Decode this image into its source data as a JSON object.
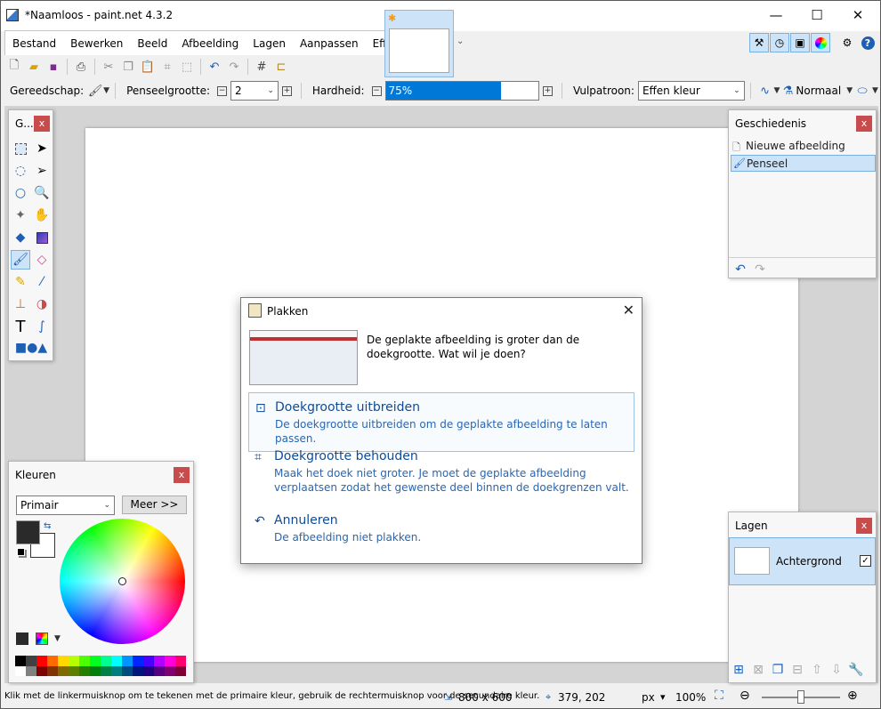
{
  "window": {
    "title": "*Naamloos - paint.net 4.3.2",
    "minimize": "—",
    "maximize": "☐",
    "close": "✕"
  },
  "menu": [
    "Bestand",
    "Bewerken",
    "Beeld",
    "Afbeelding",
    "Lagen",
    "Aanpassen",
    "Effecten"
  ],
  "toolbar": {
    "icons": [
      "new-icon",
      "open-icon",
      "save-icon",
      "print-icon",
      "cut-icon",
      "copy-icon",
      "paste-icon",
      "crop-icon",
      "deselect-icon",
      "undo-icon",
      "redo-icon",
      "grid-icon",
      "ruler-icon"
    ]
  },
  "options": {
    "tool_label": "Gereedschap:",
    "brush_label": "Penseelgrootte:",
    "brush_value": "2",
    "hardness_label": "Hardheid:",
    "hardness_value": "75%",
    "hardness_fraction": 0.75,
    "fill_label": "Vulpatroon:",
    "fill_value": "Effen kleur",
    "blend_value": "Normaal"
  },
  "tools_panel": {
    "title": "G...",
    "close": "x"
  },
  "history": {
    "title": "Geschiedenis",
    "close": "x",
    "items": [
      {
        "label": "Nieuwe afbeelding",
        "selected": false
      },
      {
        "label": "Penseel",
        "selected": true
      }
    ]
  },
  "layers": {
    "title": "Lagen",
    "close": "x",
    "layer_name": "Achtergrond",
    "visible_check": "✓"
  },
  "colors": {
    "title": "Kleuren",
    "close": "x",
    "mode": "Primair",
    "more_button": "Meer >>",
    "palette": [
      "#000000",
      "#404040",
      "#ff0000",
      "#ff6a00",
      "#ffd800",
      "#b6ff00",
      "#4cff00",
      "#00ff21",
      "#00ff90",
      "#00ffff",
      "#0094ff",
      "#0026ff",
      "#4800ff",
      "#b200ff",
      "#ff00dc",
      "#ff006e",
      "#ffffff",
      "#808080",
      "#7f0000",
      "#7f3300",
      "#7f6a00",
      "#5b7f00",
      "#267f00",
      "#007f0e",
      "#007f46",
      "#007f7f",
      "#004a7f",
      "#00137f",
      "#21007f",
      "#57007f",
      "#7f006e",
      "#7f0037"
    ]
  },
  "dialog": {
    "title": "Plakken",
    "close": "✕",
    "message": "De geplakte afbeelding is groter dan de doekgrootte. Wat wil je doen?",
    "options": [
      {
        "title": "Doekgrootte uitbreiden",
        "desc": "De doekgrootte uitbreiden om de geplakte afbeelding te laten passen."
      },
      {
        "title": "Doekgrootte behouden",
        "desc": "Maak het doek niet groter. Je moet de geplakte afbeelding verplaatsen zodat het gewenste deel binnen de doekgrenzen valt."
      },
      {
        "title": "Annuleren",
        "desc": "De afbeelding niet plakken."
      }
    ]
  },
  "status": {
    "hint": "Klik met de linkermuisknop om te tekenen met de primaire kleur, gebruik de rechtermuisknop voor de secundaire kleur.",
    "size": "800 x 600",
    "pos": "379, 202",
    "unit": "px",
    "zoom": "100%"
  }
}
